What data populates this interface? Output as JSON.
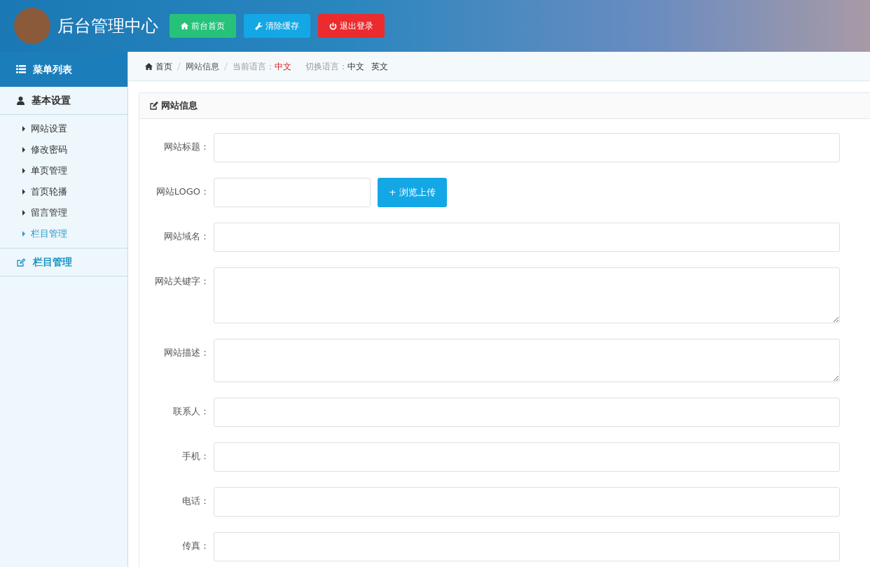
{
  "header": {
    "title": "后台管理中心",
    "buttons": [
      {
        "label": "前台首页",
        "kind": "home"
      },
      {
        "label": "清除缓存",
        "kind": "wrench"
      },
      {
        "label": "退出登录",
        "kind": "power"
      }
    ]
  },
  "sidebar": {
    "heading": "菜单列表",
    "groups": [
      {
        "label": "基本设置",
        "kind": "user",
        "selected": false,
        "items": [
          {
            "label": "网站设置",
            "selected": false
          },
          {
            "label": "修改密码",
            "selected": false
          },
          {
            "label": "单页管理",
            "selected": false
          },
          {
            "label": "首页轮播",
            "selected": false
          },
          {
            "label": "留言管理",
            "selected": false
          },
          {
            "label": "栏目管理",
            "selected": true
          }
        ]
      },
      {
        "label": "栏目管理",
        "kind": "edit",
        "selected": true
      }
    ]
  },
  "breadcrumb": {
    "items": [
      "首页",
      "网站信息"
    ],
    "current_language_label": "当前语言：",
    "current_language": "中文",
    "switch_label": "切换语言：",
    "languages": [
      "中文",
      "英文"
    ]
  },
  "panel": {
    "title": "网站信息",
    "fields": [
      {
        "label": "网站标题：",
        "kind": "input"
      },
      {
        "label": "网站LOGO：",
        "kind": "upload",
        "button": "+ 浏览上传"
      },
      {
        "label": "网站域名：",
        "kind": "input"
      },
      {
        "label": "网站关键字：",
        "kind": "textarea"
      },
      {
        "label": "网站描述：",
        "kind": "textarea_small"
      },
      {
        "label": "联系人：",
        "kind": "input"
      },
      {
        "label": "手机：",
        "kind": "input"
      },
      {
        "label": "电话：",
        "kind": "input"
      },
      {
        "label": "传真：",
        "kind": "input"
      }
    ]
  }
}
